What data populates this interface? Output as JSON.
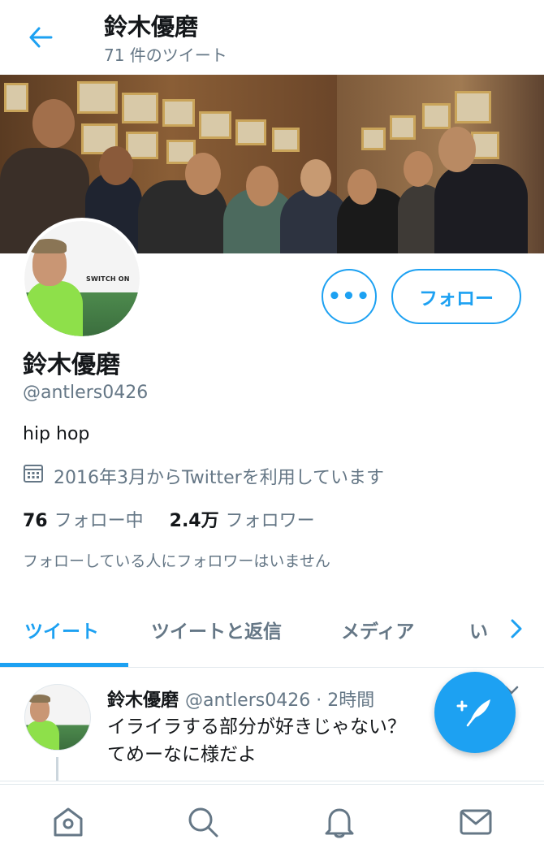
{
  "header": {
    "title": "鈴木優磨",
    "subtitle": "71 件のツイート"
  },
  "profile": {
    "name": "鈴木優磨",
    "handle": "@antlers0426",
    "bio": "hip hop",
    "joined": "2016年3月からTwitterを利用しています",
    "following_count": "76",
    "following_label": "フォロー中",
    "followers_count": "2.4万",
    "followers_label": "フォロワー",
    "no_mutual_followers": "フォローしている人にフォロワーはいません",
    "avatar_text": "SWITCH ON"
  },
  "actions": {
    "more_label": "•••",
    "follow_label": "フォロー"
  },
  "tabs": [
    {
      "label": "ツイート",
      "active": true
    },
    {
      "label": "ツイートと返信",
      "active": false
    },
    {
      "label": "メディア",
      "active": false
    },
    {
      "label": "い",
      "active": false
    }
  ],
  "tweet": {
    "name": "鈴木優磨",
    "handle": "@antlers0426",
    "time": "· 2時間",
    "text_line1": "イライラする部分が好きじゃない？",
    "text_line2": "てめーなに様だよ"
  },
  "icons": {
    "back": "back-arrow-icon",
    "calendar": "calendar-icon",
    "compose": "compose-tweet-icon",
    "home": "home-icon",
    "search": "search-icon",
    "notifications": "bell-icon",
    "messages": "mail-icon"
  },
  "colors": {
    "accent": "#1da1f2",
    "secondary_text": "#657786",
    "primary_text": "#14171a"
  }
}
